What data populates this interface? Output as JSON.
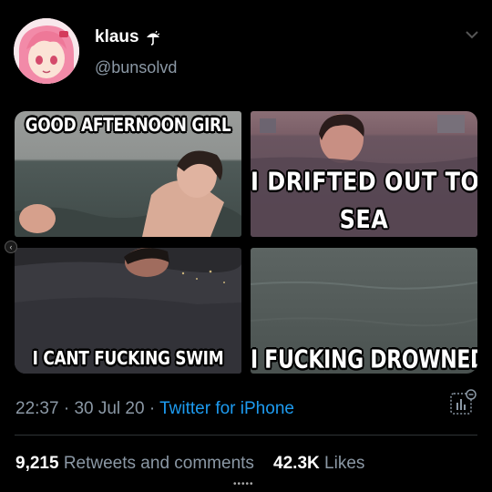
{
  "user": {
    "display_name": "klaus",
    "handle": "@bunsolvd",
    "avatar_icon": "anime-girl-avatar",
    "name_emoji_icon": "umbrella-icon"
  },
  "tweet_images": [
    {
      "caption": "GOOD AFTERNOON GIRL"
    },
    {
      "caption_line1": "I DRIFTED OUT TO",
      "caption_line2": "SEA"
    },
    {
      "caption": "I CANT FUCKING SWIM"
    },
    {
      "caption": "I FUCKING DROWNED"
    }
  ],
  "meta": {
    "time": "22:37",
    "sep1": " · ",
    "date": "30 Jul 20",
    "sep2": " · ",
    "source": "Twitter for iPhone"
  },
  "stats": {
    "retweets_count": "9,215",
    "retweets_label": "Retweets and comments",
    "likes_count": "42.3K",
    "likes_label": "Likes"
  },
  "colors": {
    "background": "#000000",
    "secondary_text": "#8b98a5",
    "link": "#1d9bf0"
  }
}
